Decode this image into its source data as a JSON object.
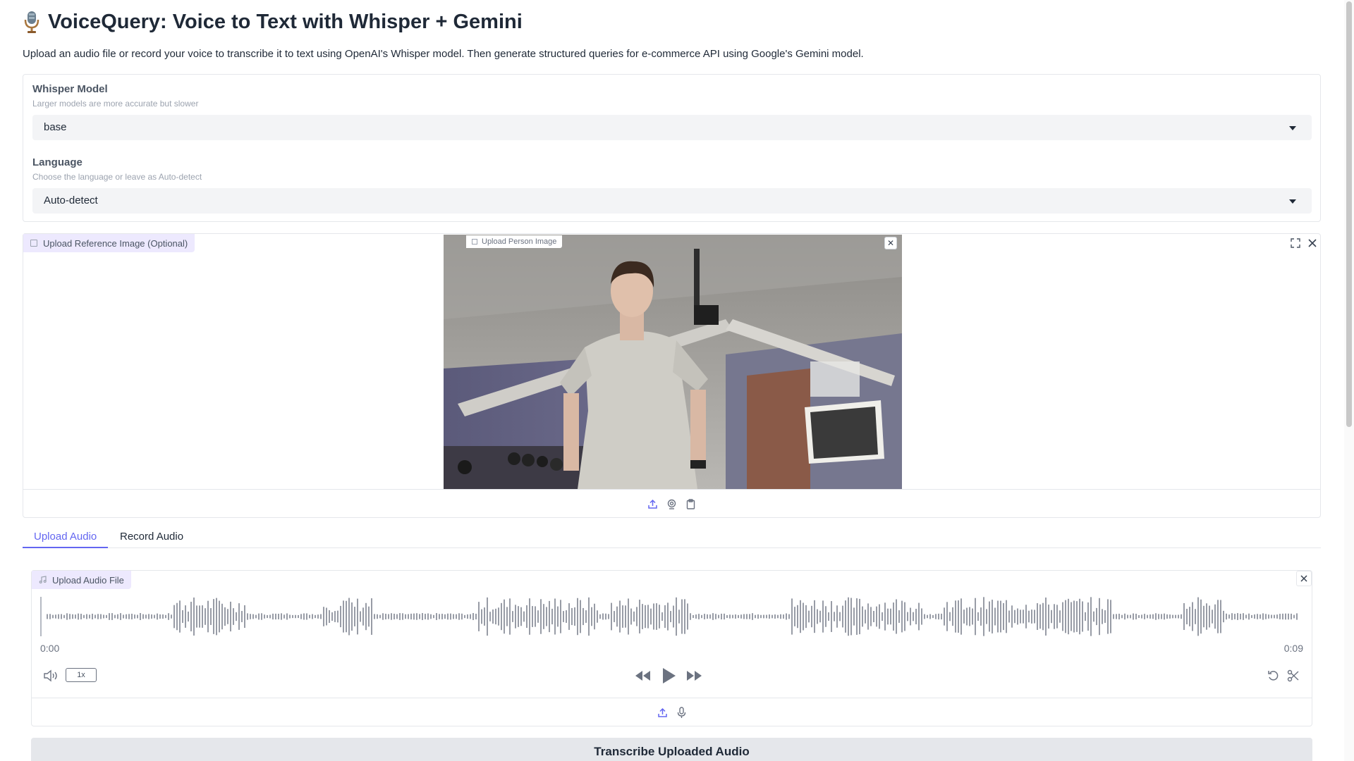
{
  "app": {
    "title": "VoiceQuery: Voice to Text with Whisper + Gemini",
    "title_icon": "studio-microphone-emoji",
    "description": "Upload an audio file or record your voice to transcribe it to text using OpenAI's Whisper model. Then generate structured queries for e-commerce API using Google's Gemini model."
  },
  "whisper_model": {
    "label": "Whisper Model",
    "info": "Larger models are more accurate but slower",
    "value": "base"
  },
  "language": {
    "label": "Language",
    "info": "Choose the language or leave as Auto-detect",
    "value": "Auto-detect"
  },
  "reference_image": {
    "label": "Upload Reference Image (Optional)",
    "preview_label": "Upload Person Image",
    "source_icons": [
      "upload-icon",
      "webcam-icon",
      "clipboard-icon"
    ]
  },
  "tabs": [
    {
      "label": "Upload Audio",
      "active": true
    },
    {
      "label": "Record Audio",
      "active": false
    }
  ],
  "audio": {
    "label": "Upload Audio File",
    "current_time": "0:00",
    "duration": "0:09",
    "playback_rate": "1x",
    "source_icons": [
      "upload-icon",
      "microphone-icon"
    ]
  },
  "actions": {
    "transcribe_label": "Transcribe Uploaded Audio"
  },
  "colors": {
    "accent": "#6366f1",
    "label_bg": "#ede9fe",
    "button_bg": "#e5e7eb",
    "input_bg": "#f3f4f6"
  }
}
